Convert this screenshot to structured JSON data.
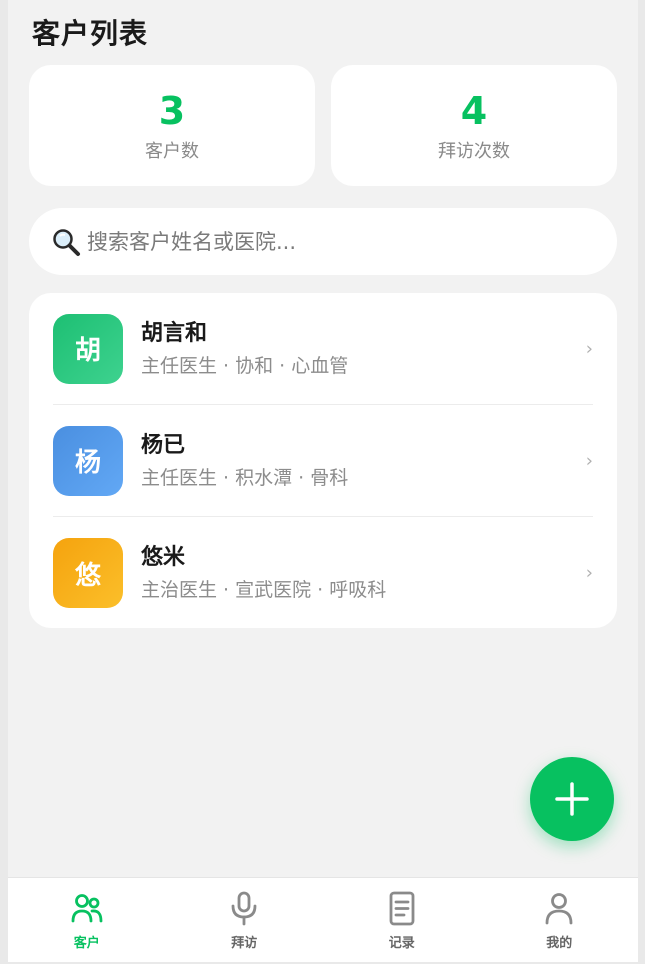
{
  "page_title": "客户列表",
  "stats": [
    {
      "value": "3",
      "label": "客户数"
    },
    {
      "value": "4",
      "label": "拜访次数"
    }
  ],
  "search": {
    "placeholder": "搜索客户姓名或医院..."
  },
  "customers": [
    {
      "avatar": "胡",
      "name": "胡言和",
      "meta": "主任医生 · 协和 · 心血管",
      "color_from": "#1dbf73",
      "color_to": "#3ed28f"
    },
    {
      "avatar": "杨",
      "name": "杨已",
      "meta": "主任医生 · 积水潭 · 骨科",
      "color_from": "#4a8fe0",
      "color_to": "#62a8f5"
    },
    {
      "avatar": "悠",
      "name": "悠米",
      "meta": "主治医生 · 宣武医院 · 呼吸科",
      "color_from": "#f5a30e",
      "color_to": "#fbbf2a"
    }
  ],
  "tabs": [
    {
      "label": "客户",
      "icon": "users-icon",
      "active": true
    },
    {
      "label": "拜访",
      "icon": "microphone-icon",
      "active": false
    },
    {
      "label": "记录",
      "icon": "document-icon",
      "active": false
    },
    {
      "label": "我的",
      "icon": "user-icon",
      "active": false
    }
  ],
  "colors": {
    "accent": "#07c160",
    "inactive": "#8a8a8a"
  }
}
